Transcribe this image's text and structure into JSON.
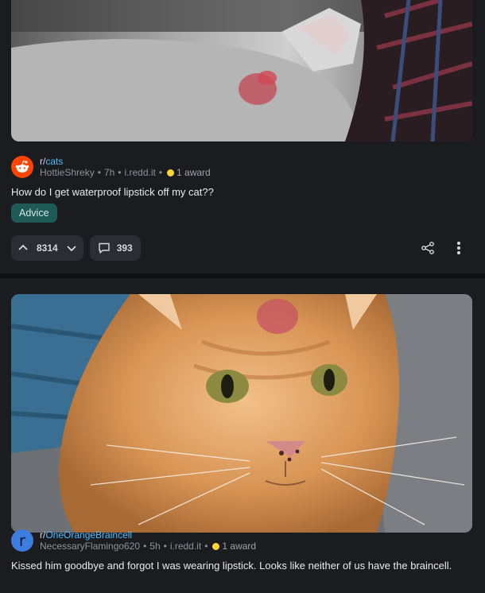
{
  "posts": [
    {
      "subreddit_prefix": "r/",
      "subreddit": "cats",
      "author": "HottieShreky",
      "age": "7h",
      "domain": "i.redd.it",
      "awards": "1 award",
      "title": "How do I get waterproof lipstick off my cat??",
      "flair": "Advice",
      "upvotes": "8314",
      "comments": "393",
      "avatar_icon": "reddit-snoo-icon"
    },
    {
      "subreddit_prefix": "r/",
      "subreddit": "OneOrangeBraincell",
      "author": "NecessaryFlamingo620",
      "age": "5h",
      "domain": "i.redd.it",
      "awards": "1 award",
      "avatar_letter": "r",
      "title": "Kissed him goodbye and forgot I was wearing lipstick. Looks like neither of us have the braincell."
    }
  ],
  "colors": {
    "background": "#0e1113",
    "card": "#1a1c1f",
    "link": "#4fbcff",
    "flair": "#1f5a57",
    "award": "#ffd635",
    "avatar_orange": "#ff4500",
    "avatar_blue": "#3d7de0"
  }
}
